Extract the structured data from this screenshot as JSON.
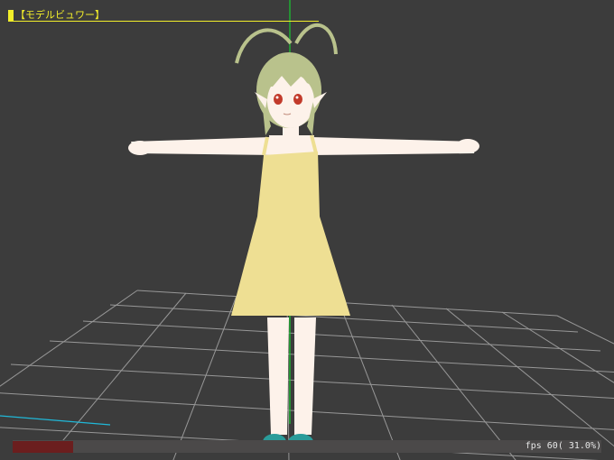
{
  "viewer": {
    "title": "【モデルビュワー】",
    "fps_label": "fps 60( 31.0%)",
    "load_fraction": 0.31
  },
  "colors": {
    "background": "#3c3c3c",
    "title": "#f2ee2a",
    "grid": "#a8a8a8",
    "axis_y": "#18c830",
    "axis_x": "#d83030",
    "axis_z": "#20b8d8",
    "load_bar": "#6b1e1e"
  },
  "icons": [
    "title-marker-icon"
  ]
}
